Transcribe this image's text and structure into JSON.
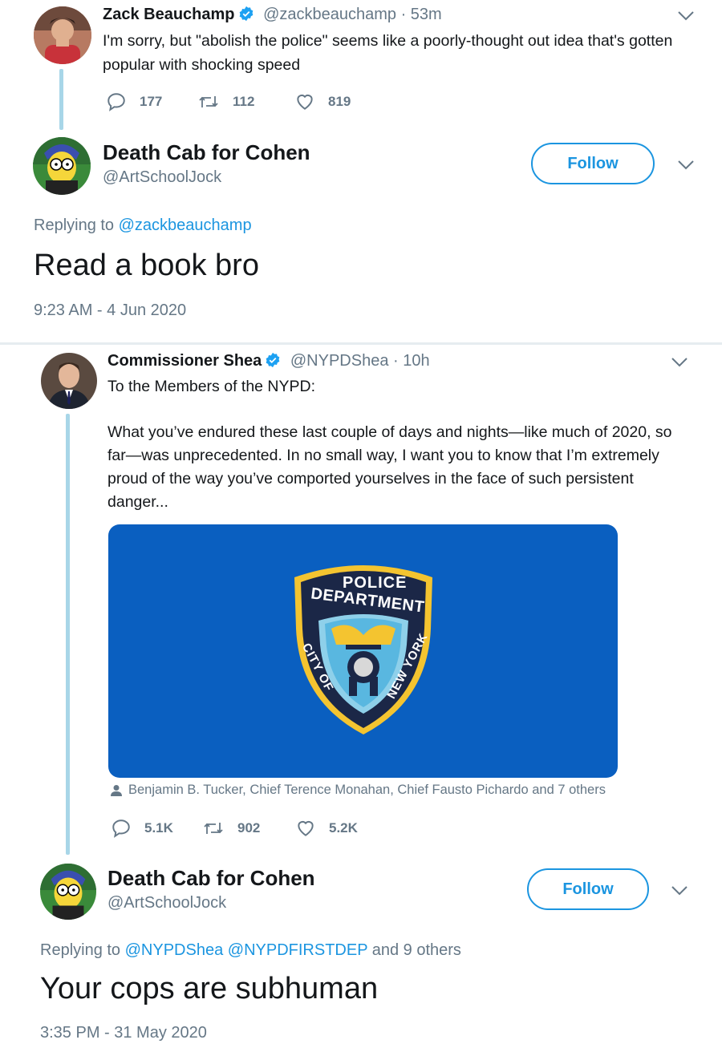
{
  "tweet1": {
    "name": "Zack Beauchamp",
    "handle": "@zackbeauchamp",
    "time": "· 53m",
    "text": "I'm sorry, but \"abolish the police\" seems like a poorly-thought out idea that's gotten popular with shocking speed",
    "replies": "177",
    "retweets": "112",
    "likes": "819"
  },
  "reply1": {
    "name": "Death Cab for Cohen",
    "handle": "@ArtSchoolJock",
    "follow_label": "Follow",
    "replying_prefix": "Replying to",
    "replying_to": "@zackbeauchamp",
    "text": "Read a book bro",
    "timestamp": "9:23 AM - 4 Jun 2020"
  },
  "tweet2": {
    "name": "Commissioner Shea",
    "handle": "@NYPDShea",
    "time": "· 10h",
    "text_line1": "To the Members of the NYPD:",
    "text_body": "What you’ve endured these last couple of days and nights—like much of 2020, so far—was unprecedented. In no small way, I want you to know that I’m extremely proud of the way you’ve comported yourselves in the face of such persistent danger...",
    "badge_top": "POLICE",
    "badge_mid": "DEPARTMENT",
    "badge_left": "CITY OF",
    "badge_right": "NEW YORK",
    "tagged": "Benjamin B. Tucker, Chief Terence Monahan, Chief Fausto Pichardo and 7 others",
    "replies": "5.1K",
    "retweets": "902",
    "likes": "5.2K"
  },
  "reply2": {
    "name": "Death Cab for Cohen",
    "handle": "@ArtSchoolJock",
    "follow_label": "Follow",
    "replying_prefix": "Replying to",
    "replying_to_1": "@NYPDShea",
    "replying_to_2": "@NYPDFIRSTDEP",
    "replying_suffix": "and 9 others",
    "text": "Your cops are subhuman",
    "timestamp": "3:35 PM - 31 May 2020"
  },
  "colors": {
    "accent": "#1b95e0",
    "muted": "#657786",
    "thread_line": "#a8d6e8",
    "nypd_blue": "#0a5fc0"
  }
}
